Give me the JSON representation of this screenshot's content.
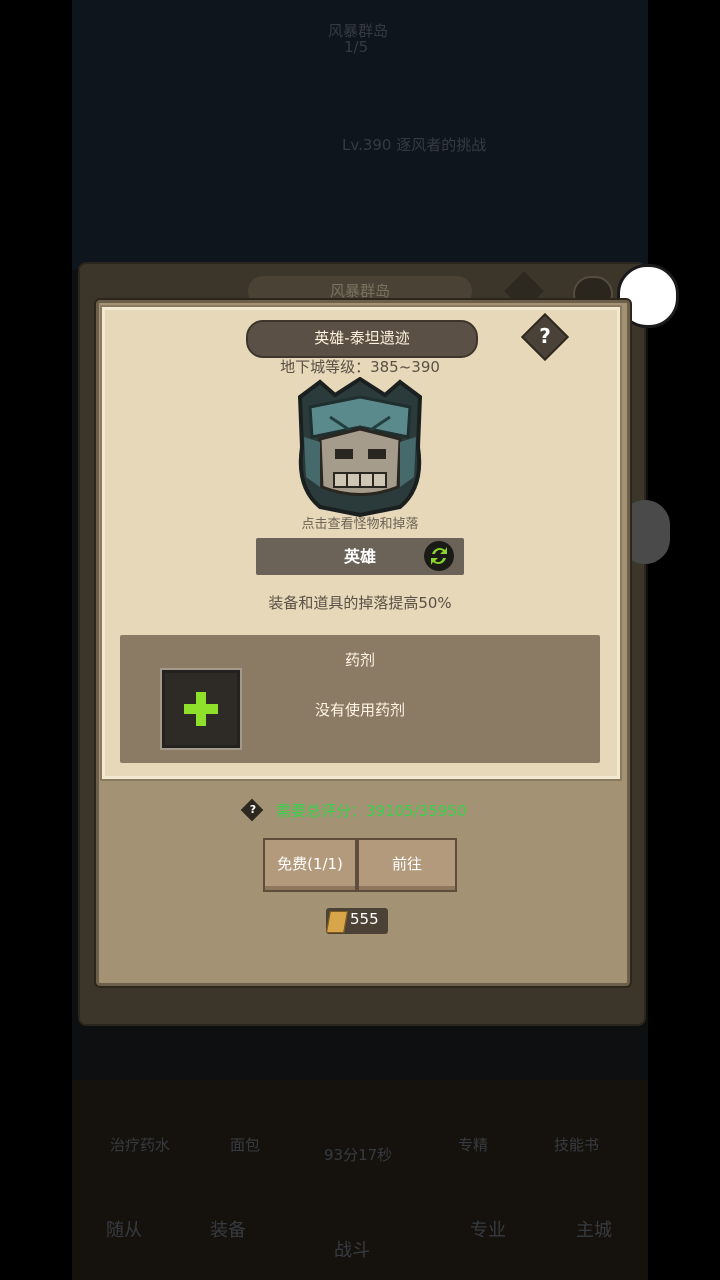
{
  "dialog": {
    "title": "英雄-泰坦遗迹",
    "help_label": "?",
    "dungeon_level": "地下城等级：385~390",
    "monster_hint": "点击查看怪物和掉落",
    "difficulty": "英雄",
    "drop_bonus": "装备和道具的掉落提高50%",
    "potion": {
      "title": "药剂",
      "status": "没有使用药剂"
    },
    "requirement": {
      "icon_label": "?",
      "text": "需要总评分：39105/35950",
      "color": "#3ad14b"
    },
    "buttons": {
      "free": "免费(1/1)",
      "go": "前往"
    },
    "cost": {
      "value": "555",
      "icon": "scroll-icon"
    }
  },
  "background": {
    "tab_title": "风暴群岛",
    "header_title": "风暴群岛",
    "header_sub": "1/5",
    "level_text": "Lv.390 逐风者的挑战",
    "bottom_items": [
      "治疗药水",
      "面包",
      "专精",
      "技能书"
    ],
    "timer": "93分17秒",
    "nav": [
      "随从",
      "装备",
      "战斗",
      "专业",
      "主城"
    ]
  }
}
